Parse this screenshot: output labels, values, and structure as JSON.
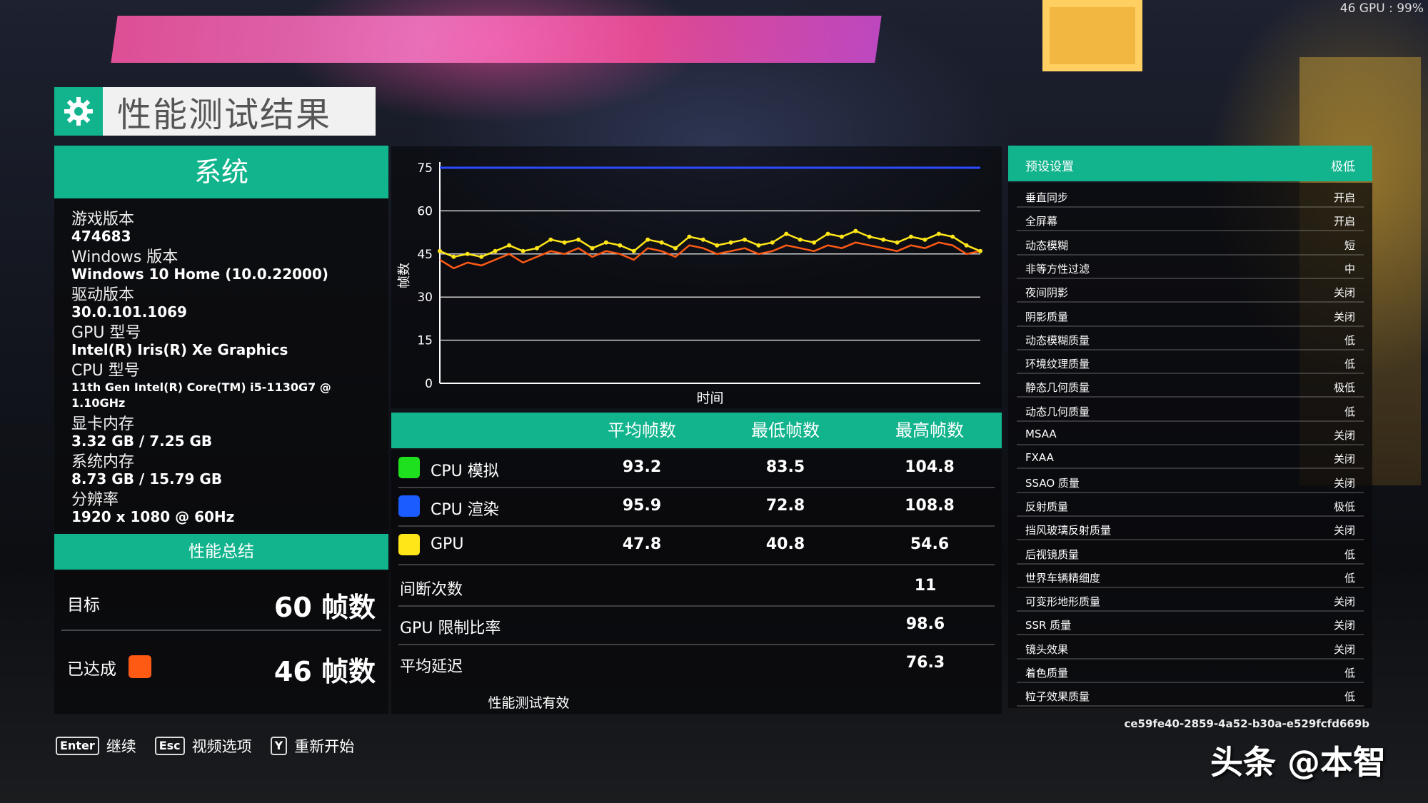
{
  "hud": {
    "gpu_readout": "46 GPU : 99%"
  },
  "title": "性能测试结果",
  "system": {
    "heading": "系统",
    "items": [
      {
        "label": "游戏版本",
        "value": "474683"
      },
      {
        "label": "Windows 版本",
        "value": "Windows 10 Home (10.0.22000)"
      },
      {
        "label": "驱动版本",
        "value": "30.0.101.1069"
      },
      {
        "label": "GPU 型号",
        "value": "Intel(R) Iris(R) Xe Graphics"
      },
      {
        "label": "CPU 型号",
        "value": "11th Gen Intel(R) Core(TM) i5-1130G7 @ 1.10GHz"
      },
      {
        "label": "显卡内存",
        "value": "3.32 GB / 7.25 GB"
      },
      {
        "label": "系统内存",
        "value": "8.73 GB / 15.79 GB"
      },
      {
        "label": "分辨率",
        "value": "1920 x 1080 @ 60Hz"
      }
    ]
  },
  "summary": {
    "heading": "性能总结",
    "target_label": "目标",
    "target_value": "60 帧数",
    "achieved_label": "已达成",
    "achieved_value": "46 帧数",
    "achieved_color": "#ff5a14"
  },
  "chart_data": {
    "type": "line",
    "xlabel": "时间",
    "ylabel": "帧数",
    "ylim": [
      0,
      75
    ],
    "yticks": [
      0,
      15,
      30,
      45,
      60,
      75
    ],
    "grid": true,
    "series": [
      {
        "color": "#2c4bff",
        "values": [
          75,
          75,
          75,
          75,
          75,
          75,
          75,
          75,
          75,
          75,
          75,
          75,
          75,
          75,
          75,
          75,
          75,
          75,
          75,
          75,
          75,
          75,
          75,
          75,
          75,
          75,
          75,
          75,
          75,
          75,
          75,
          75,
          75,
          75,
          75,
          75,
          75,
          75,
          75,
          75
        ]
      },
      {
        "color": "#ff5a14",
        "values": [
          43,
          40,
          42,
          41,
          43,
          45,
          42,
          44,
          46,
          45,
          47,
          44,
          46,
          45,
          43,
          47,
          46,
          44,
          48,
          47,
          45,
          46,
          47,
          45,
          46,
          48,
          47,
          46,
          48,
          47,
          49,
          48,
          47,
          46,
          48,
          47,
          49,
          48,
          45,
          46
        ]
      },
      {
        "color": "#ffe619",
        "values": [
          46,
          44,
          45,
          44,
          46,
          48,
          46,
          47,
          50,
          49,
          50,
          47,
          49,
          48,
          46,
          50,
          49,
          47,
          51,
          50,
          48,
          49,
          50,
          48,
          49,
          52,
          50,
          49,
          52,
          51,
          53,
          51,
          50,
          49,
          51,
          50,
          52,
          51,
          48,
          46
        ]
      }
    ]
  },
  "stats": {
    "headers": [
      "平均帧数",
      "最低帧数",
      "最高帧数"
    ],
    "rows": [
      {
        "name": "CPU 模拟",
        "color": "#1ee01e",
        "avg": "93.2",
        "min": "83.5",
        "max": "104.8"
      },
      {
        "name": "CPU 渲染",
        "color": "#1a5cff",
        "avg": "95.9",
        "min": "72.8",
        "max": "108.8"
      },
      {
        "name": "GPU",
        "color": "#ffe619",
        "avg": "47.8",
        "min": "40.8",
        "max": "54.6"
      }
    ],
    "extra": [
      {
        "name": "间断次数",
        "value": "11"
      },
      {
        "name": "GPU 限制比率",
        "value": "98.6"
      },
      {
        "name": "平均延迟",
        "value": "76.3"
      }
    ],
    "valid_text": "性能测试有效"
  },
  "presets": {
    "heading": "预设设置",
    "heading_value": "极低",
    "rows": [
      {
        "label": "垂直同步",
        "value": "开启"
      },
      {
        "label": "全屏幕",
        "value": "开启"
      },
      {
        "label": "动态模糊",
        "value": "短"
      },
      {
        "label": "非等方性过滤",
        "value": "中"
      },
      {
        "label": "夜间阴影",
        "value": "关闭"
      },
      {
        "label": "阴影质量",
        "value": "关闭"
      },
      {
        "label": "动态模糊质量",
        "value": "低"
      },
      {
        "label": "环境纹理质量",
        "value": "低"
      },
      {
        "label": "静态几何质量",
        "value": "极低"
      },
      {
        "label": "动态几何质量",
        "value": "低"
      },
      {
        "label": "MSAA",
        "value": "关闭"
      },
      {
        "label": "FXAA",
        "value": "关闭"
      },
      {
        "label": "SSAO 质量",
        "value": "关闭"
      },
      {
        "label": "反射质量",
        "value": "极低"
      },
      {
        "label": "挡风玻璃反射质量",
        "value": "关闭"
      },
      {
        "label": "后视镜质量",
        "value": "低"
      },
      {
        "label": "世界车辆精细度",
        "value": "低"
      },
      {
        "label": "可变形地形质量",
        "value": "关闭"
      },
      {
        "label": "SSR 质量",
        "value": "关闭"
      },
      {
        "label": "镜头效果",
        "value": "关闭"
      },
      {
        "label": "着色质量",
        "value": "低"
      },
      {
        "label": "粒子效果质量",
        "value": "低"
      }
    ]
  },
  "uuid": "ce59fe40-2859-4a52-b30a-e529fcfd669b",
  "footer": [
    {
      "key": "Enter",
      "label": "继续"
    },
    {
      "key": "Esc",
      "label": "视频选项"
    },
    {
      "key": "Y",
      "label": "重新开始"
    }
  ],
  "watermark": "头条 @本智",
  "colors": {
    "accent": "#11b48c"
  }
}
